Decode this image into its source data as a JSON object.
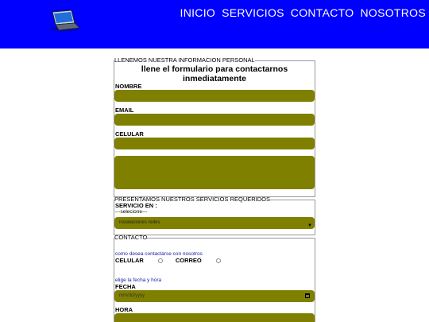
{
  "header": {
    "logo_icon": "laptop-icon",
    "nav": [
      "INICIO",
      "SERVICIOS",
      "CONTACTO",
      "NOSOTROS"
    ],
    "bg_color": "#0000ff"
  },
  "personal": {
    "legend": "LLENEMOS NUESTRA INFORMACION PERSONAL",
    "title_line1": "llene el formulario para contactarnos",
    "title_line2": "inmediatamente",
    "nombre_label": "NOMBRE",
    "email_label": "EMAIL",
    "celular_label": "CELULAR",
    "field_color": "#808000"
  },
  "servicios": {
    "legend": "PRESENTAMOS NUESTROS SERVICIOS REQUERIDOS",
    "servicio_label": "SERVICIO EN :",
    "placeholder_option": "---selecione---",
    "selected": "instalaciones redes"
  },
  "contacto": {
    "legend": "CONTACTO",
    "prompt": "como desea contactarse con nosotros",
    "option_celular": "CELULAR",
    "option_correo": "CORREO",
    "fecha_prompt": "elige la fecha y hora",
    "fecha_label": "FECHA",
    "fecha_placeholder": "mm/dd/yyyy",
    "hora_label": "HORA"
  }
}
